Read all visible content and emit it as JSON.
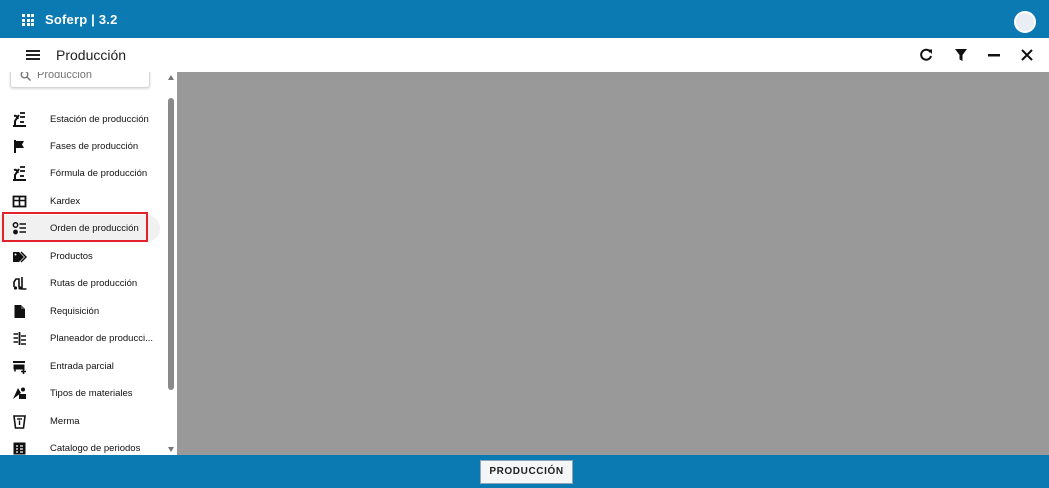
{
  "app": {
    "title": "Soferp | 3.2"
  },
  "header": {
    "title": "Producción"
  },
  "search": {
    "placeholder": "Producción"
  },
  "sidebar": {
    "items": [
      {
        "label": "Estación de producción",
        "icon": "cultivation-icon"
      },
      {
        "label": "Fases de producción",
        "icon": "flag-icon"
      },
      {
        "label": "Fórmula de producción",
        "icon": "cultivation-icon"
      },
      {
        "label": "Kardex",
        "icon": "table-icon"
      },
      {
        "label": "Orden de producción",
        "icon": "checklist-icon",
        "selected": true
      },
      {
        "label": "Productos",
        "icon": "tags-icon"
      },
      {
        "label": "Rutas de producción",
        "icon": "forklift-icon"
      },
      {
        "label": "Requisición",
        "icon": "document-icon"
      },
      {
        "label": "Planeador de producci...",
        "icon": "planner-icon"
      },
      {
        "label": "Entrada parcial",
        "icon": "cart-add-icon"
      },
      {
        "label": "Tipos de materiales",
        "icon": "materials-icon"
      },
      {
        "label": "Merma",
        "icon": "waste-bin-icon"
      },
      {
        "label": "Catalogo de periodos",
        "icon": "catalog-icon"
      }
    ]
  },
  "footer": {
    "button_label": "PRODUCCIÓN"
  },
  "colors": {
    "brand": "#0b7ab3",
    "content_bg": "#999999",
    "highlight": "#e3232b"
  }
}
